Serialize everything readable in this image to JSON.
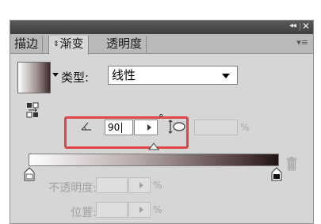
{
  "panel": {
    "title_controls": {
      "collapse": "◂◂",
      "close": "✕"
    },
    "tabs": [
      {
        "label": "描边",
        "active": false
      },
      {
        "label": "渐变",
        "prefix": "⇕",
        "active": true
      },
      {
        "label": "透明度",
        "active": false
      }
    ],
    "menu_icon": "▾≡"
  },
  "gradient": {
    "type_label": "类型:",
    "type_value": "线性",
    "angle_value": "90",
    "degree_symbol": "°",
    "aspect_value": "",
    "aspect_unit": "%",
    "opacity_label": "不透明度:",
    "opacity_unit": "%",
    "location_label": "位置:",
    "location_unit": "%"
  },
  "colors": {
    "highlight": "#e04545",
    "panel_bg": "#d6d6d6",
    "titlebar": "#4a4a4a"
  },
  "icons": [
    "reverse-gradient-icon",
    "angle-icon",
    "aspect-ratio-icon",
    "midpoint-marker-icon",
    "color-stop-icon",
    "trash-icon",
    "close-icon",
    "collapse-icon",
    "panel-menu-icon"
  ]
}
